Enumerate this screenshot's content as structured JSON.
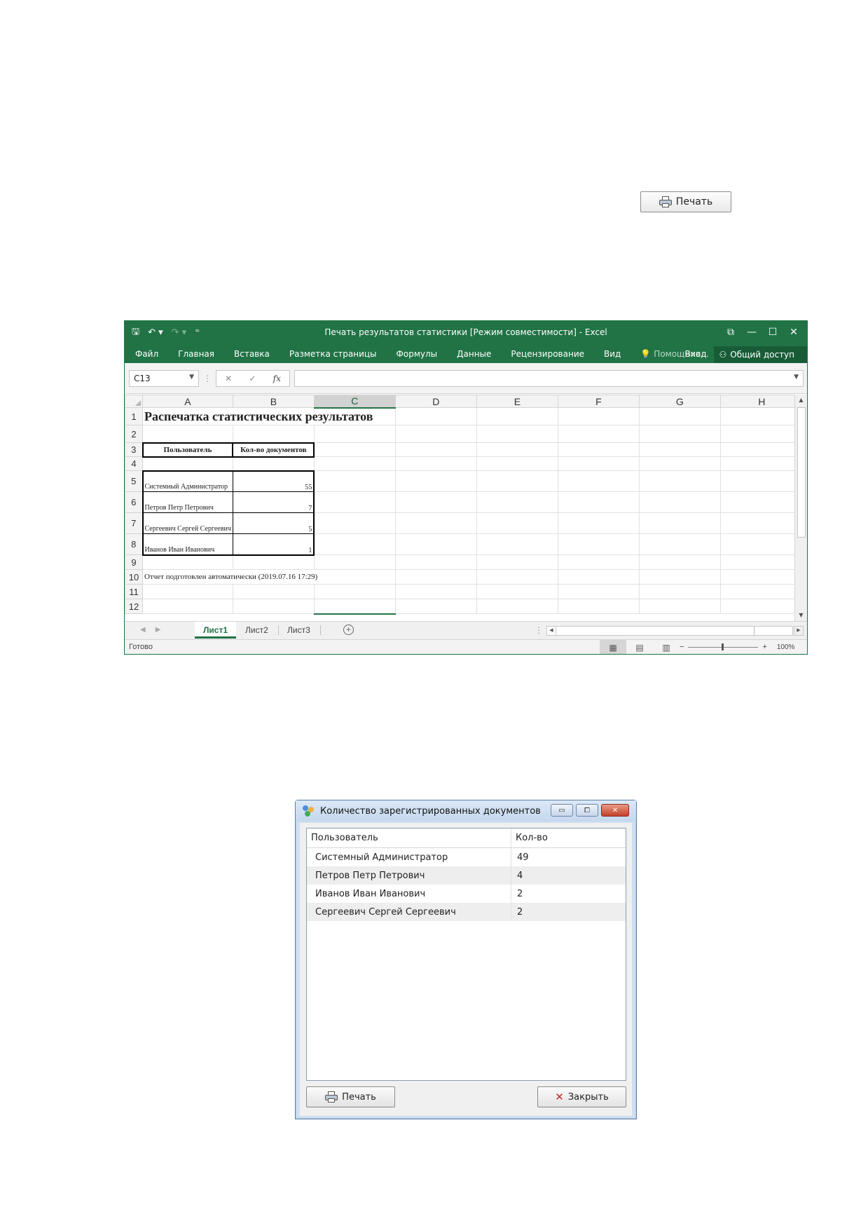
{
  "top_print_button": {
    "label": "Печать"
  },
  "excel": {
    "qat": {
      "save": "🖫",
      "undo": "↶ ▾",
      "redo": "↷ ▾",
      "customize": "⁼"
    },
    "title": "Печать результатов статистики  [Режим совместимости] - Excel",
    "win_buttons": {
      "ribbon_display": "⧉",
      "minimize": "—",
      "maximize": "☐",
      "close": "✕"
    },
    "ribbon_tabs": [
      "Файл",
      "Главная",
      "Вставка",
      "Разметка страницы",
      "Формулы",
      "Данные",
      "Рецензирование",
      "Вид"
    ],
    "tell_me": "Помощник...",
    "sign_in": "Вход",
    "share": "Общий доступ",
    "name_box": "C13",
    "fx_cancel": "✕",
    "fx_enter": "✓",
    "fx_label": "fx",
    "columns": [
      "A",
      "B",
      "C",
      "D",
      "E",
      "F",
      "G",
      "H"
    ],
    "active_column": "C",
    "row_numbers": [
      "1",
      "2",
      "3",
      "4",
      "5",
      "6",
      "7",
      "8",
      "9",
      "10",
      "11",
      "12"
    ],
    "sheet_title": "Распечатка статистических результатов",
    "table_headers": [
      "Пользователь",
      "Кол-во документов"
    ],
    "rows": [
      {
        "user": "Системный Администратор",
        "count": "55"
      },
      {
        "user": "Петров Петр Петрович",
        "count": "7"
      },
      {
        "user": "Сергеевич Сергей Сергеевич",
        "count": "5"
      },
      {
        "user": "Иванов Иван Иванович",
        "count": "1"
      }
    ],
    "note": "Отчет подготовлен автоматически (2019.07.16 17:29)",
    "sheet_tabs": [
      "Лист1",
      "Лист2",
      "Лист3"
    ],
    "active_sheet": "Лист1",
    "status": "Готово",
    "zoom_minus": "−",
    "zoom_plus": "+",
    "zoom": "100%"
  },
  "dialog": {
    "title": "Количество зарегистрированных документов",
    "btn_minimize": "▭",
    "btn_maximize": "⧠",
    "btn_close": "✕",
    "columns": [
      "Пользователь",
      "Кол-во"
    ],
    "rows": [
      {
        "user": "Системный Администратор",
        "count": "49"
      },
      {
        "user": "Петров Петр Петрович",
        "count": "4"
      },
      {
        "user": "Иванов Иван Иванович",
        "count": "2"
      },
      {
        "user": "Сергеевич Сергей Сергеевич",
        "count": "2"
      }
    ],
    "print_label": "Печать",
    "close_label": "Закрыть"
  }
}
